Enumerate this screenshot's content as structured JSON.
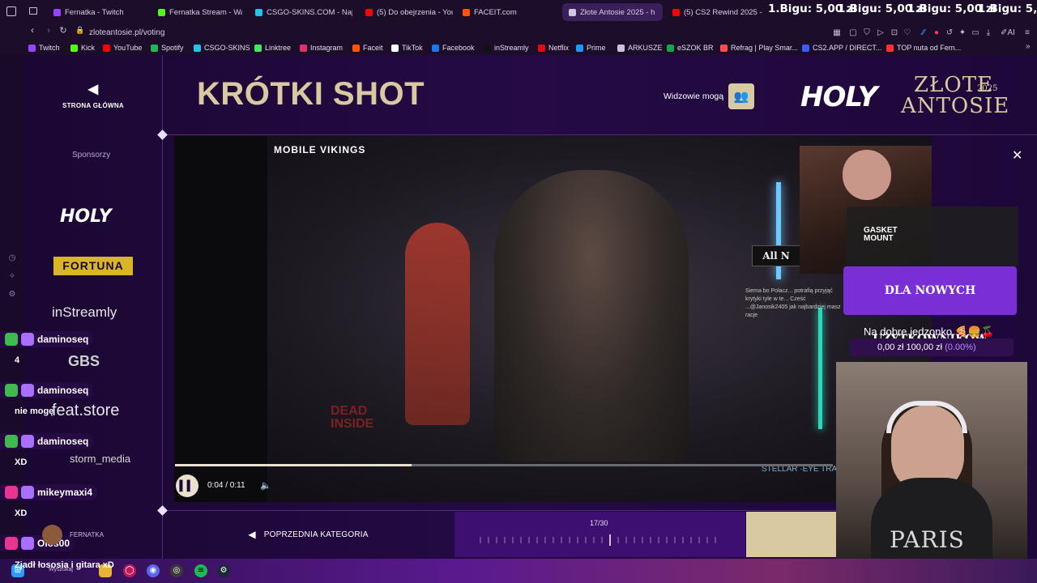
{
  "browser": {
    "tabs": [
      {
        "label": "Fernatka - Twitch",
        "color": "#9146ff"
      },
      {
        "label": "Fernatka Stream - Watch",
        "color": "#53fc18"
      },
      {
        "label": "CSGO-SKINS.COM - Najw",
        "color": "#22c5e8"
      },
      {
        "label": "(5) Do obejrzenia - YouTu",
        "color": "#ff0000"
      },
      {
        "label": "FACEIT.com",
        "color": "#ff5500"
      },
      {
        "label": "Złote Antosie 2025 - h",
        "color": "#cfc6df"
      },
      {
        "label": "(5) CS2 Rewind 2025 - Yo",
        "color": "#ff0000"
      }
    ],
    "bigu": [
      "1.Bigu: 5,00 zł",
      "1.Bigu: 5,00 zł",
      "1.Bigu: 5,00 zł",
      "1.Bigu: 5,00 zł"
    ],
    "url": "zloteantosie.pl/voting",
    "bookmarks": [
      {
        "label": "Twitch",
        "color": "#9146ff"
      },
      {
        "label": "Kick",
        "color": "#53fc18"
      },
      {
        "label": "YouTube",
        "color": "#ff0000"
      },
      {
        "label": "Spotify",
        "color": "#1db954"
      },
      {
        "label": "CSGO-SKINS",
        "color": "#22c5e8"
      },
      {
        "label": "Linktree",
        "color": "#43e660"
      },
      {
        "label": "Instagram",
        "color": "#e1306c"
      },
      {
        "label": "Faceit",
        "color": "#ff5500"
      },
      {
        "label": "TikTok",
        "color": "#ffffff"
      },
      {
        "label": "Facebook",
        "color": "#1877f2"
      },
      {
        "label": "inStreamly",
        "color": "#111111"
      },
      {
        "label": "Netflix",
        "color": "#e50914"
      },
      {
        "label": "Prime",
        "color": "#1a98ff"
      },
      {
        "label": "ARKUSZE",
        "color": "#cfc2e0"
      },
      {
        "label": "eSZOK BR",
        "color": "#16a34a"
      },
      {
        "label": "Refrag | Play Smar...",
        "color": "#ff4d4d"
      },
      {
        "label": "CS2.APP / DIRECT...",
        "color": "#3b5bff"
      },
      {
        "label": "TOP nuta od Fern...",
        "color": "#ff3333"
      }
    ]
  },
  "site": {
    "home_label": "STRONA GŁÓWNA",
    "title": "KRÓTKI SHOT",
    "viewers_label": "Widzowie mogą",
    "holy_logo": "HOLY",
    "zlote_logo": "ZŁOTE ANTOSIE",
    "zlote_year": "2025",
    "sponsors_label": "Sponsorzy",
    "sponsors": [
      "HOLY",
      "FORTUNA",
      "inStreamly",
      "GBS",
      "feat.store",
      "storm_media"
    ],
    "video": {
      "brand": "MOBILE VIKINGS",
      "time": "0:04 / 0:11",
      "progress": 0.36
    },
    "prev_category": "POPRZEDNIA KATEGORIA",
    "counter": "17/30",
    "counter_current": 17,
    "counter_total": 30
  },
  "overlay": {
    "gasket_title": "GASKET\nMOUNT",
    "dla_nowych": "DLA NOWYCH UŻYTKOWNIKÓW",
    "goal_title": "Na dobre jedzonko 🍕🍔🍒",
    "goal_amounts": "0,00 zł  100,00 zł",
    "goal_pct": "(0.00%)",
    "allnew": "All N",
    "deadinside": "DEAD\nINSIDE",
    "stellar": "STELLAR ·EYE TRACK",
    "paris": "PARIS",
    "chat_overlay": "Siema bo Polacz... potrafią przyjąć krytyki tyle w te... Cześć ...@Janosik2405 jak najbardziej masz racje"
  },
  "chat": [
    {
      "user": "daminoseq",
      "msg": "4",
      "badge_color": "#3fb950"
    },
    {
      "user": "daminoseq",
      "msg": "nie mogę",
      "badge_color": "#3fb950"
    },
    {
      "user": "daminoseq",
      "msg": "XD",
      "badge_color": "#3fb950"
    },
    {
      "user": "mikeymaxi4",
      "msg": "XD",
      "badge_color": "#e8358f"
    },
    {
      "user": "Olos00",
      "msg": "",
      "badge_color": "#e8358f"
    }
  ],
  "fernatka_name": "FERNATKA",
  "taskbar_msg": "Zjadł łososia i gitara xD",
  "search_stub": "Wyszukaj"
}
